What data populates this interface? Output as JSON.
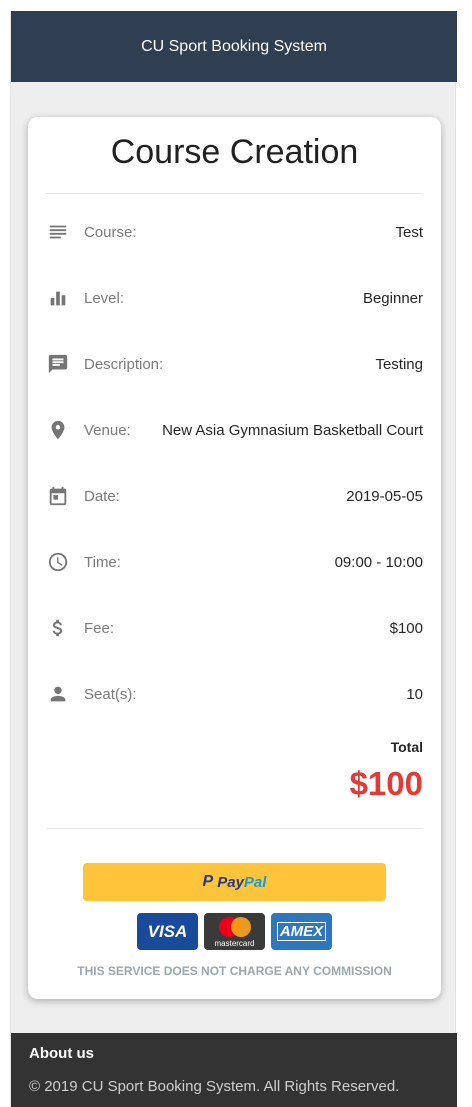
{
  "header": {
    "title": "CU Sport Booking System"
  },
  "card": {
    "title": "Course Creation",
    "rows": [
      {
        "icon": "notes-icon",
        "label": "Course:",
        "value": "Test"
      },
      {
        "icon": "bar-chart-icon",
        "label": "Level:",
        "value": "Beginner"
      },
      {
        "icon": "comment-icon",
        "label": "Description:",
        "value": "Testing"
      },
      {
        "icon": "location-pin-icon",
        "label": "Venue:",
        "value": "New Asia Gymnasium Basketball Court"
      },
      {
        "icon": "calendar-icon",
        "label": "Date:",
        "value": "2019-05-05"
      },
      {
        "icon": "clock-icon",
        "label": "Time:",
        "value": "09:00 - 10:00"
      },
      {
        "icon": "dollar-icon",
        "label": "Fee:",
        "value": "$100"
      },
      {
        "icon": "person-icon",
        "label": "Seat(s):",
        "value": "10"
      }
    ],
    "total_label": "Total",
    "total_value": "$100",
    "total_color": "#e53935"
  },
  "payment": {
    "paypal_pay": "Pay",
    "paypal_pal": "Pal",
    "visa": "VISA",
    "mastercard": "mastercard",
    "amex": "AMEX",
    "commission_note": "THIS SERVICE DOES NOT CHARGE ANY COMMISSION"
  },
  "footer": {
    "about": "About us",
    "copyright": "© 2019 CU Sport Booking System. All Rights Reserved."
  }
}
